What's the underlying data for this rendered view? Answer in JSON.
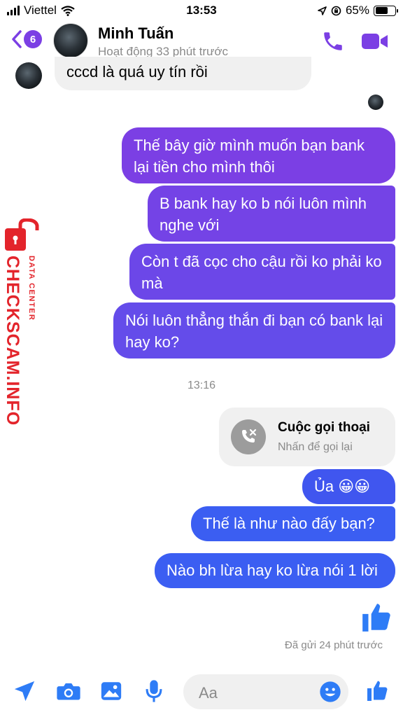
{
  "status_bar": {
    "carrier": "Viettel",
    "time": "13:53",
    "battery": "65%",
    "battery_level": 0.65
  },
  "header": {
    "unread_count": "6",
    "contact_name": "Minh Tuấn",
    "contact_status": "Hoạt động 33 phút trước"
  },
  "messages": [
    {
      "direction": "incoming",
      "text": "cccd là quá uy tín rồi"
    },
    {
      "direction": "outgoing",
      "text": "Thế bây giờ mình muốn bạn bank lại tiền cho mình thôi"
    },
    {
      "direction": "outgoing",
      "text": "B bank hay ko b nói luôn mình nghe với"
    },
    {
      "direction": "outgoing",
      "text": "Còn t đã cọc cho cậu rồi ko phải ko mà"
    },
    {
      "direction": "outgoing",
      "text": "Nói luôn thẳng thắn đi bạn có bank lại hay ko?"
    },
    {
      "direction": "outgoing",
      "text": "Ủa 😀😀"
    },
    {
      "direction": "outgoing",
      "text": "Thế là như nào đấy bạn?"
    },
    {
      "direction": "outgoing",
      "text": "Nào bh lừa hay ko lừa nói 1 lời"
    }
  ],
  "timestamp": "13:16",
  "call_card": {
    "title": "Cuộc gọi thoại",
    "subtitle": "Nhấn để gọi lại"
  },
  "sent_status": "Đã gửi 24 phút trước",
  "composer": {
    "placeholder": "Aa"
  },
  "watermark": {
    "main": "CHECKSCAM.INFO",
    "sub": "DATA CENTER"
  },
  "colors": {
    "accent": "#7b3fe4",
    "bubble_purple": "#7b3fe4",
    "bubble_blue": "#3b5ef2",
    "incoming_bubble": "#f0f0f0",
    "like": "#2e7cf6",
    "watermark": "#e3242b"
  },
  "icons": [
    "back-chevron-icon",
    "phone-icon",
    "video-icon",
    "missed-call-icon",
    "like-icon",
    "location-arrow-icon",
    "camera-icon",
    "image-icon",
    "microphone-icon",
    "emoji-icon"
  ]
}
